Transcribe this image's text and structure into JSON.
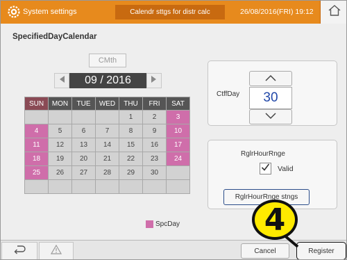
{
  "header": {
    "title": "System settings",
    "subtitle": "Calendr sttgs for distr calc",
    "datetime": "26/08/2016(FRI) 19:12",
    "home_icon": "home-icon",
    "settings_icon": "gear-icon"
  },
  "page_title": "SpecifiedDayCalendar",
  "calendar": {
    "cmth_label": "CMth",
    "month_label": "09 / 2016",
    "weekdays": [
      "SUN",
      "MON",
      "TUE",
      "WED",
      "THU",
      "FRI",
      "SAT"
    ],
    "weeks": [
      [
        {
          "d": "",
          "spc": false
        },
        {
          "d": "",
          "spc": false
        },
        {
          "d": "",
          "spc": false
        },
        {
          "d": "",
          "spc": false
        },
        {
          "d": "1",
          "spc": false
        },
        {
          "d": "2",
          "spc": false
        },
        {
          "d": "3",
          "spc": true
        }
      ],
      [
        {
          "d": "4",
          "spc": true
        },
        {
          "d": "5",
          "spc": false
        },
        {
          "d": "6",
          "spc": false
        },
        {
          "d": "7",
          "spc": false
        },
        {
          "d": "8",
          "spc": false
        },
        {
          "d": "9",
          "spc": false
        },
        {
          "d": "10",
          "spc": true
        }
      ],
      [
        {
          "d": "11",
          "spc": true
        },
        {
          "d": "12",
          "spc": false
        },
        {
          "d": "13",
          "spc": false
        },
        {
          "d": "14",
          "spc": false
        },
        {
          "d": "15",
          "spc": false
        },
        {
          "d": "16",
          "spc": false
        },
        {
          "d": "17",
          "spc": true
        }
      ],
      [
        {
          "d": "18",
          "spc": true
        },
        {
          "d": "19",
          "spc": false
        },
        {
          "d": "20",
          "spc": false
        },
        {
          "d": "21",
          "spc": false
        },
        {
          "d": "22",
          "spc": false
        },
        {
          "d": "23",
          "spc": false
        },
        {
          "d": "24",
          "spc": true
        }
      ],
      [
        {
          "d": "25",
          "spc": true
        },
        {
          "d": "26",
          "spc": false
        },
        {
          "d": "27",
          "spc": false
        },
        {
          "d": "28",
          "spc": false
        },
        {
          "d": "29",
          "spc": false
        },
        {
          "d": "30",
          "spc": false
        },
        {
          "d": "",
          "spc": false
        }
      ],
      [
        {
          "d": "",
          "spc": false
        },
        {
          "d": "",
          "spc": false
        },
        {
          "d": "",
          "spc": false
        },
        {
          "d": "",
          "spc": false
        },
        {
          "d": "",
          "spc": false
        },
        {
          "d": "",
          "spc": false
        },
        {
          "d": "",
          "spc": false
        }
      ]
    ],
    "legend_label": "SpcDay"
  },
  "cutoff": {
    "label": "CtffDay",
    "value": "30"
  },
  "regular_hours": {
    "title": "RglrHourRnge",
    "valid_label": "Valid",
    "valid_checked": true,
    "settings_button": "RglrHourRnge stngs"
  },
  "step_marker": "4",
  "footer": {
    "back_icon": "back-arrow-icon",
    "warning_icon": "warning-icon",
    "cancel_label": "Cancel",
    "register_label": "Register"
  },
  "colors": {
    "header": "#e78a1d",
    "special_day": "#cf6eaa",
    "value_text": "#2147a8",
    "step_marker": "#ffea00"
  }
}
